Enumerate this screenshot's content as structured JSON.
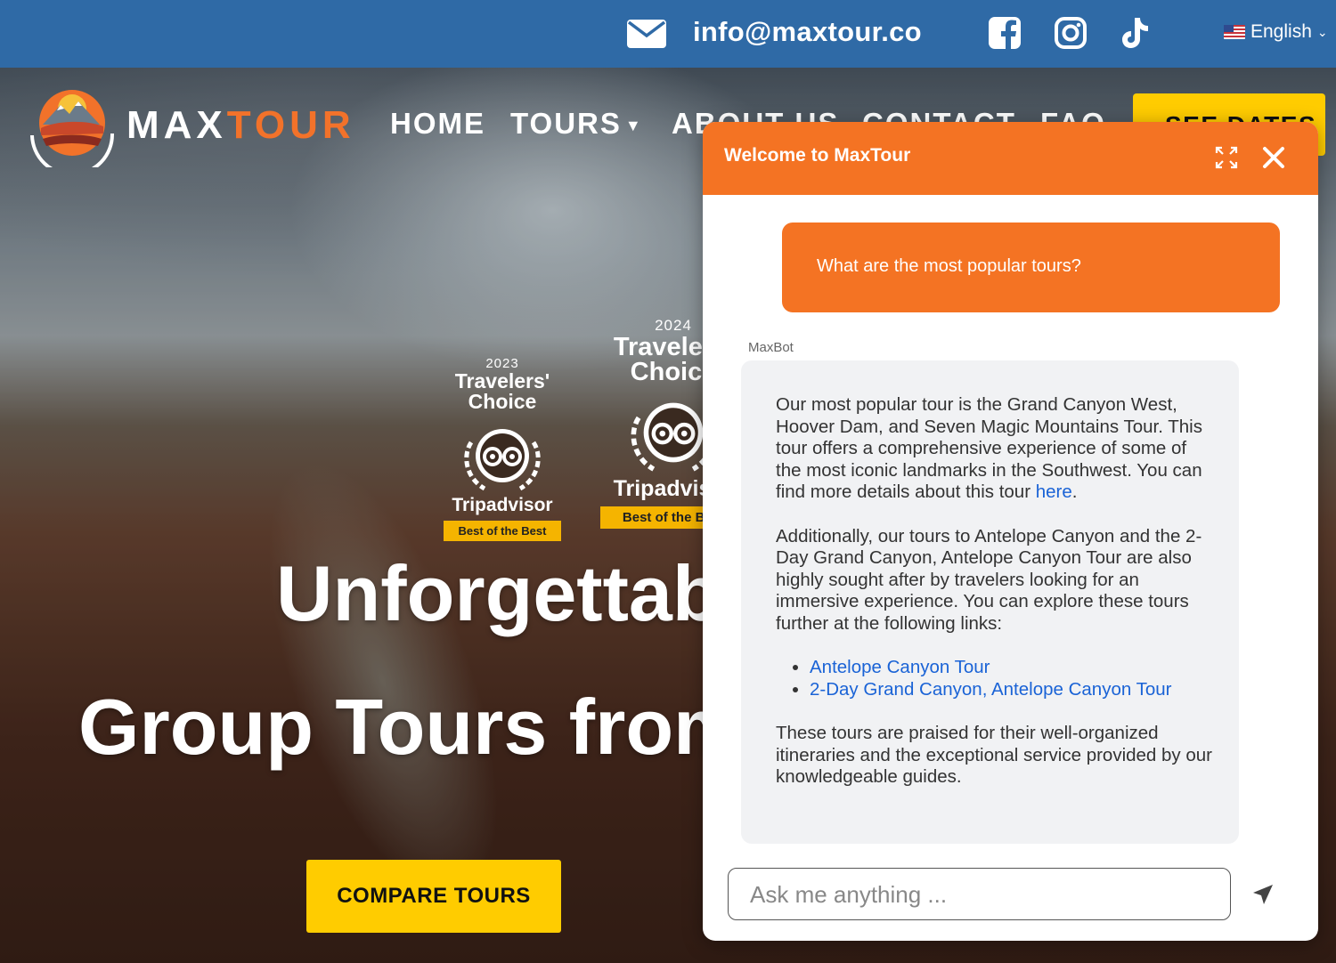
{
  "topbar": {
    "email": "info@maxtour.co",
    "social_icons": [
      "facebook-icon",
      "instagram-icon",
      "tiktok-icon"
    ],
    "language": "English",
    "color": "#2f6aa6"
  },
  "logo": {
    "part1": "MAX",
    "part2": "TOUR",
    "accent": "#f2722a"
  },
  "nav": {
    "home": "HOME",
    "tours": "TOURS",
    "about": "ABOUT US",
    "contact": "CONTACT",
    "faq": "FAQ",
    "see_dates": "SEE DATES"
  },
  "badges": [
    {
      "year": "2023",
      "line1": "Travelers'",
      "line2": "Choice",
      "brand": "Tripadvisor",
      "ribbon": "Best of the Best"
    },
    {
      "year": "2024",
      "line1": "Travelers'",
      "line2": "Choice",
      "brand": "Tripadvisor",
      "ribbon": "Best of the Best"
    }
  ],
  "hero": {
    "headline_line1": "Unforgettable",
    "headline_line2": "Group Tours from",
    "cta": "COMPARE TOURS",
    "cta_color": "#ffcc00"
  },
  "chat": {
    "title": "Welcome to MaxTour",
    "header_color": "#f47323",
    "user_message": "What are the most popular tours?",
    "bot_name": "MaxBot",
    "bot": {
      "p1": "Our most popular tour is the Grand Canyon West, Hoover Dam, and Seven Magic Mountains Tour. This tour offers a comprehensive experience of some of the most iconic landmarks in the Southwest. You can find more details about this tour ",
      "p1_link": "here",
      "p1_end": ".",
      "p2": "Additionally, our tours to Antelope Canyon and the 2-Day Grand Canyon, Antelope Canyon Tour are also highly sought after by travelers looking for an immersive experience. You can explore these tours further at the following links:",
      "links": [
        "Antelope Canyon Tour",
        "2-Day Grand Canyon, Antelope Canyon Tour"
      ],
      "p3": "These tours are praised for their well-organized itineraries and the exceptional service provided by our knowledgeable guides."
    },
    "input_placeholder": "Ask me anything ..."
  }
}
